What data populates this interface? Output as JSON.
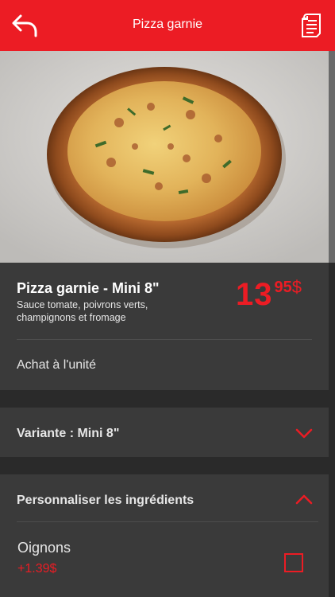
{
  "header": {
    "title": "Pizza garnie",
    "back_icon": "back-arrow-icon",
    "receipt_icon": "receipt-icon",
    "bg_color": "#ec1c24"
  },
  "product": {
    "name": "Pizza garnie - Mini 8\"",
    "description": "Sauce tomate, poivrons verts, champignons et fromage",
    "price_int": "13",
    "price_cents": "95",
    "price_currency": "$",
    "purchase_type": "Achat à l'unité"
  },
  "variant": {
    "label": "Variante : Mini 8\"",
    "chevron": "chevron-down-icon"
  },
  "customize": {
    "label": "Personnaliser les ingrédients",
    "chevron": "chevron-up-icon",
    "options": [
      {
        "name": "Oignons",
        "price": "+1.39$",
        "checked": false
      }
    ]
  },
  "accent_color": "#ec1c24"
}
